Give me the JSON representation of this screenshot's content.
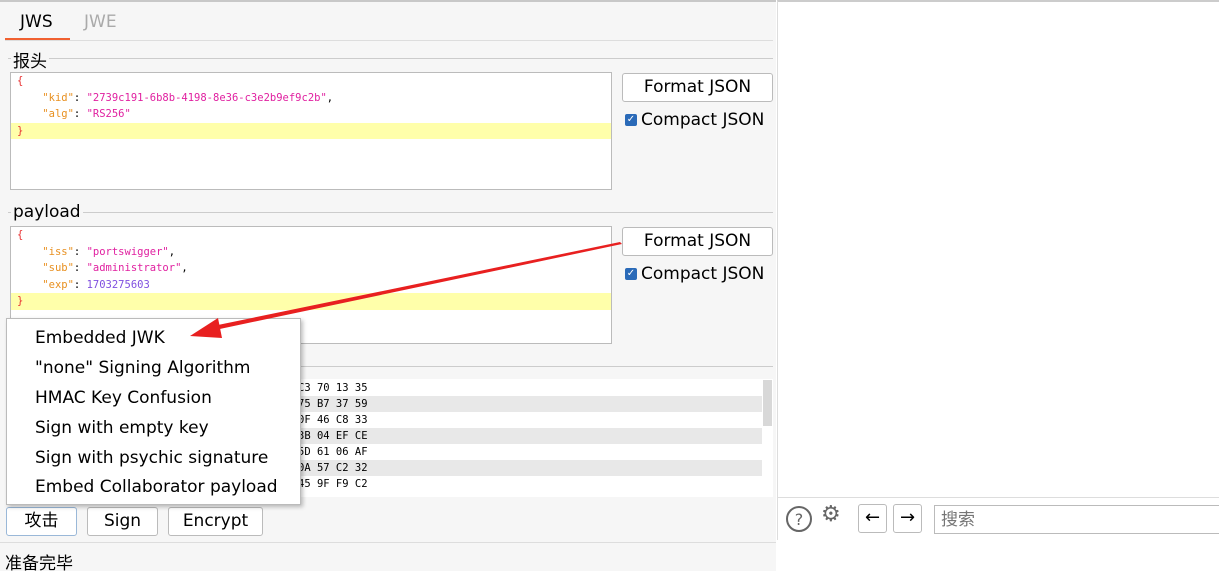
{
  "tabs": [
    {
      "label": "JWS",
      "active": true
    },
    {
      "label": "JWE",
      "active": false
    }
  ],
  "header": {
    "legend": "报头",
    "lines": [
      {
        "open": "{"
      },
      {
        "key": "\"kid\"",
        "value": "\"2739c191-6b8b-4198-8e36-c3e2b9ef9c2b\"",
        "trail": ","
      },
      {
        "key": "\"alg\"",
        "value": "\"RS256\""
      },
      {
        "close": "}"
      }
    ],
    "format_label": "Format JSON",
    "compact_label": "Compact JSON",
    "compact_checked": true
  },
  "payload": {
    "legend": "payload",
    "lines": [
      {
        "open": "{"
      },
      {
        "key": "\"iss\"",
        "value": "\"portswigger\"",
        "trail": ","
      },
      {
        "key": "\"sub\"",
        "value": "\"administrator\"",
        "trail": ","
      },
      {
        "key": "\"exp\"",
        "value": "1703275603"
      },
      {
        "close": "}"
      }
    ],
    "format_label": "Format JSON",
    "compact_label": "Compact JSON",
    "compact_checked": true
  },
  "signature": {
    "hex_rows": [
      "C3 70 13 35",
      "75 B7 37 59",
      "0F 46 C8 33",
      "3B 04 EF CE",
      "5D 61 06 AF",
      "0A 57 C2 32",
      "45 9F F9 C2"
    ]
  },
  "attack_menu": {
    "items": [
      "Embedded JWK",
      "\"none\" Signing Algorithm",
      "HMAC Key Confusion",
      "Sign with empty key",
      "Sign with psychic signature",
      "Embed Collaborator payload"
    ]
  },
  "buttons": {
    "attack": "攻击",
    "sign": "Sign",
    "encrypt": "Encrypt"
  },
  "status": "准备完毕",
  "right_toolbar": {
    "search_placeholder": "搜索",
    "icons": [
      "help-icon",
      "gear-icon",
      "arrow-left-icon",
      "arrow-right-icon"
    ]
  },
  "colors": {
    "accent": "#f06030",
    "annotation_arrow": "#e82020",
    "highlight": "#ffffaa"
  }
}
